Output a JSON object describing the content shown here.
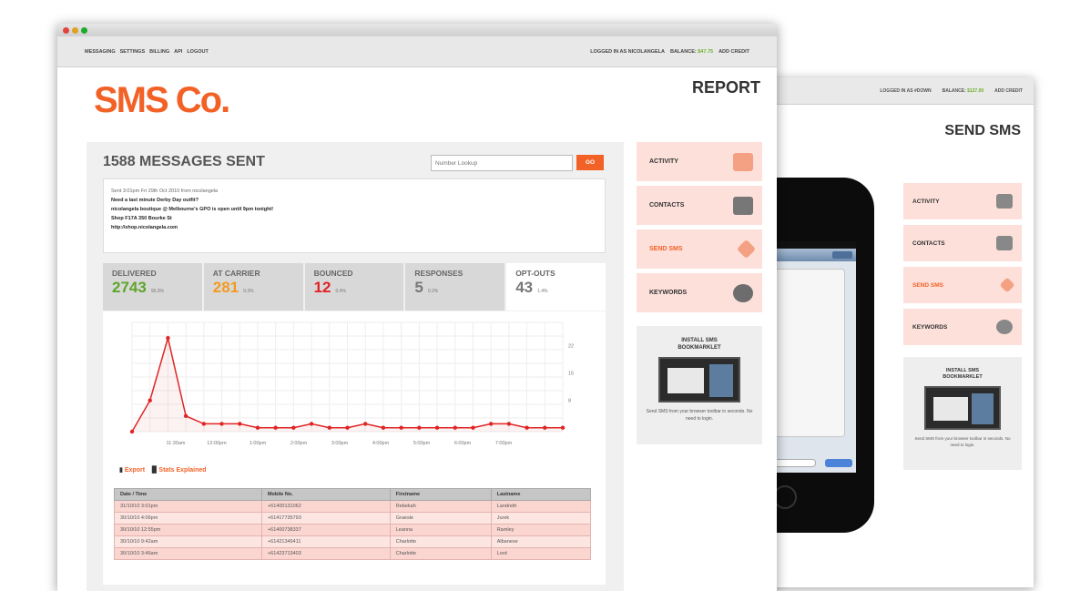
{
  "front": {
    "topnav": {
      "links": [
        "MESSAGING",
        "SETTINGS",
        "BILLING",
        "API",
        "LOGOUT"
      ],
      "logged_in": "LOGGED IN AS NICOLANGELA",
      "balance_label": "BALANCE:",
      "balance_value": "$47.75",
      "add_credit": "ADD CREDIT"
    },
    "logo": "SMS Co.",
    "page_title": "REPORT",
    "main": {
      "title": "1588 MESSAGES SENT",
      "lookup_placeholder": "Number Lookup",
      "go": "GO",
      "message": {
        "meta": "Sent 3:01pm Fri 29th Oct 2010 from nicolangela",
        "line1": "Need a last minute Derby Day outfit?",
        "line2": "nicolangela boutique @ Melbourne's GPO is open until 9pm tonight!",
        "line3": "Shop F17A 350 Bourke St",
        "line4": "http://shop.nicolangela.com"
      },
      "stats": [
        {
          "label": "DELIVERED",
          "value": "2743",
          "pct": "90.3%"
        },
        {
          "label": "AT CARRIER",
          "value": "281",
          "pct": "9.3%"
        },
        {
          "label": "BOUNCED",
          "value": "12",
          "pct": "0.4%"
        },
        {
          "label": "RESPONSES",
          "value": "5",
          "pct": "0.2%"
        },
        {
          "label": "OPT-OUTS",
          "value": "43",
          "pct": "1.4%"
        }
      ],
      "links": {
        "export": "Export",
        "stats": "Stats Explained"
      },
      "table": {
        "headers": [
          "Date / Time",
          "Mobile No.",
          "Firstname",
          "Lastname"
        ],
        "rows": [
          [
            "31/10/10 3:01pm",
            "+61400131062",
            "Rebekah",
            "Landreth"
          ],
          [
            "30/10/10 4:06pm",
            "+61417735793",
            "Graesle",
            "Jurek"
          ],
          [
            "30/10/10 12:55pm",
            "+61400738337",
            "Leanna",
            "Ramley"
          ],
          [
            "30/10/10 9:42am",
            "+61421349411",
            "Charlotte",
            "Albanese"
          ],
          [
            "30/10/10 3:46am",
            "+61423713403",
            "Charlotte",
            "Lord"
          ]
        ]
      }
    },
    "sidebar": {
      "items": [
        {
          "label": "ACTIVITY",
          "icon": "activity-screen-icon"
        },
        {
          "label": "CONTACTS",
          "icon": "contacts-card-icon"
        },
        {
          "label": "SEND SMS",
          "icon": "send-tag-icon"
        },
        {
          "label": "KEYWORDS",
          "icon": "speech-bubble-icon"
        }
      ],
      "bookmarklet": {
        "title_line1": "INSTALL SMS",
        "title_line2": "BOOKMARKLET",
        "desc": "Send SMS from your browser toolbar in seconds. No need to login."
      }
    }
  },
  "back": {
    "logged_in": "LOGGED IN AS #DOWN",
    "balance_label": "BALANCE:",
    "balance_value": "$127.00",
    "add_credit": "ADD CREDIT",
    "page_title": "SEND SMS",
    "sidebar": {
      "items": [
        {
          "label": "ACTIVITY",
          "icon": "activity-screen-icon"
        },
        {
          "label": "CONTACTS",
          "icon": "contacts-card-icon"
        },
        {
          "label": "SEND SMS",
          "icon": "send-tag-icon"
        },
        {
          "label": "KEYWORDS",
          "icon": "speech-bubble-icon"
        }
      ],
      "bookmarklet": {
        "title_line1": "INSTALL SMS",
        "title_line2": "BOOKMARKLET",
        "desc": "Send SMS from your browser toolbar in seconds. No need to login."
      }
    }
  },
  "chart_data": {
    "type": "line",
    "x_ticks": [
      "11:30am",
      "12:00pm",
      "1:00pm",
      "2:00pm",
      "3:00pm",
      "4:00pm",
      "5:00pm",
      "6:00pm",
      "7:00pm"
    ],
    "y_ticks": [
      "22",
      "15",
      "8"
    ],
    "series": [
      {
        "values": [
          0,
          8,
          24,
          4,
          2,
          2,
          2,
          1,
          1,
          1,
          2,
          1,
          1,
          2,
          1,
          1,
          1,
          1,
          1,
          1,
          2,
          2,
          1,
          1,
          1
        ]
      }
    ],
    "ylim": [
      0,
      28
    ],
    "color": "#e02424"
  }
}
